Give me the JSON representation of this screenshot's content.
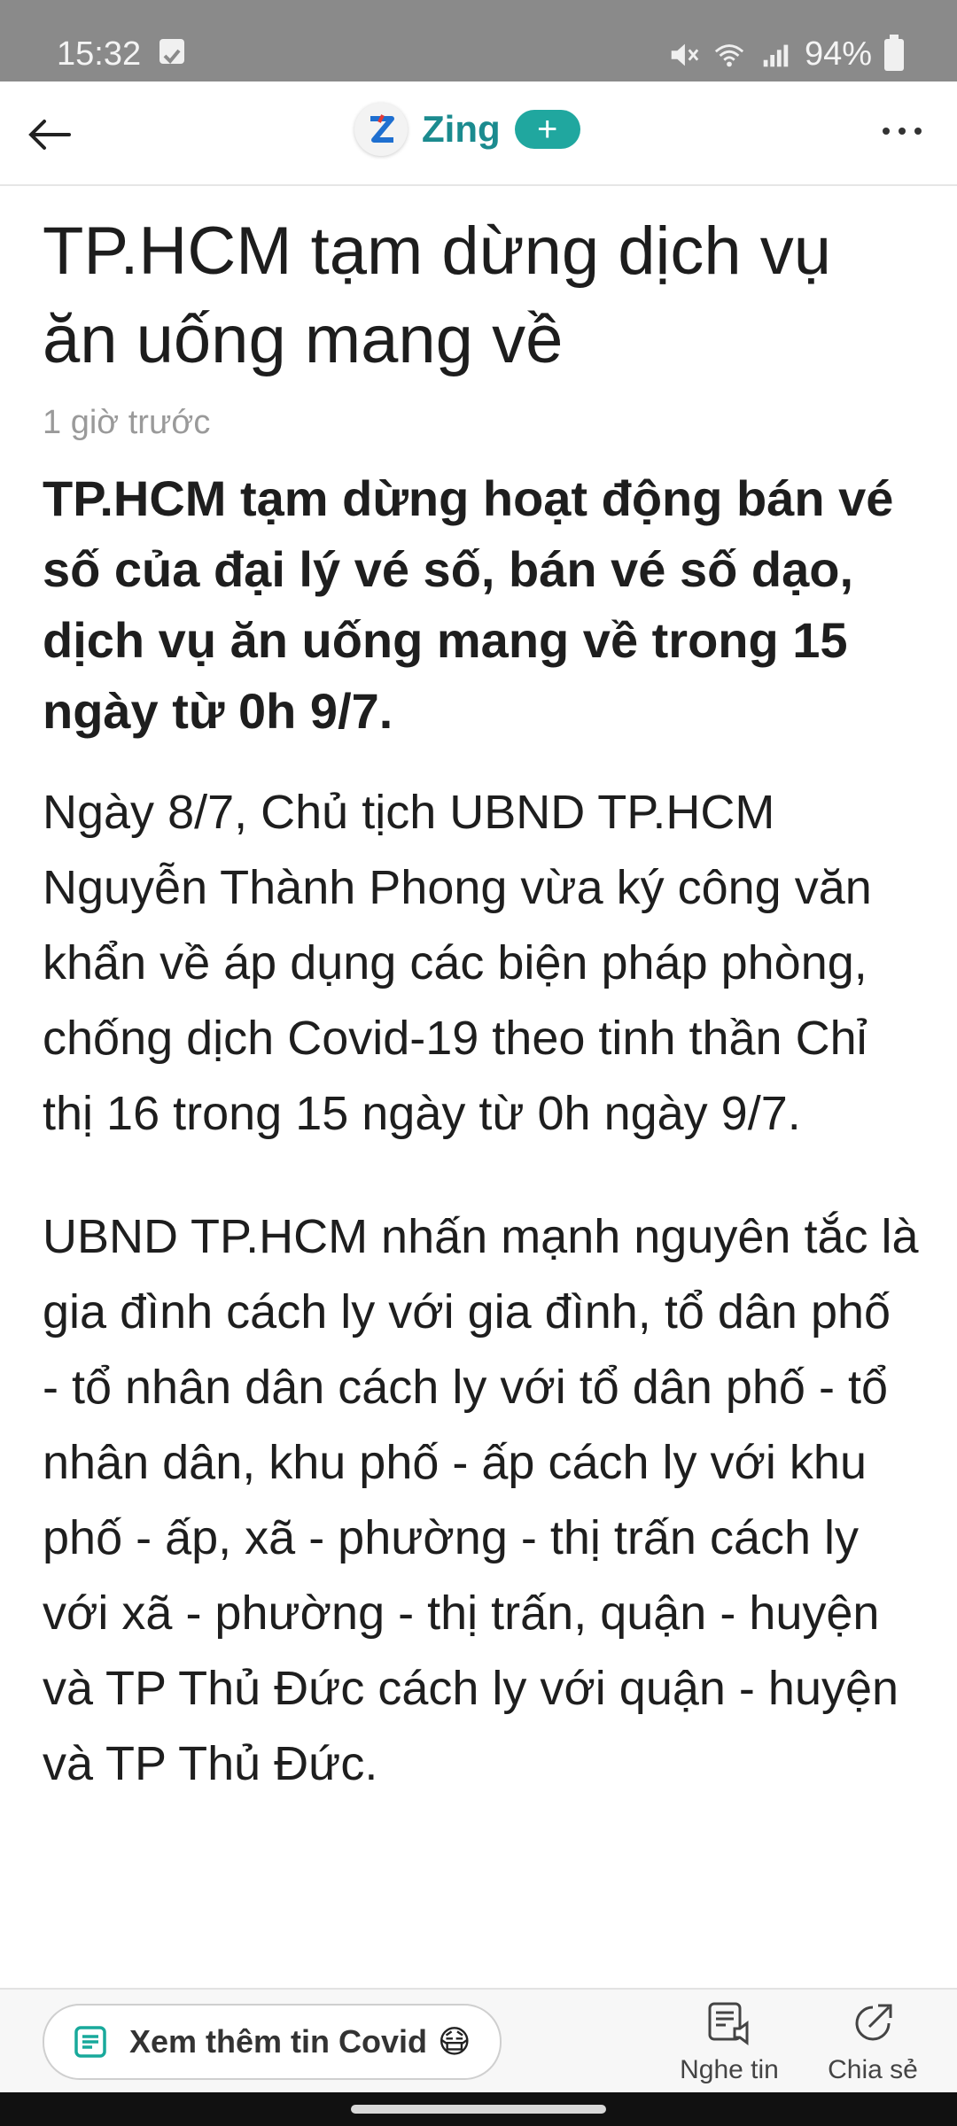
{
  "status": {
    "time": "15:32",
    "battery": "94%"
  },
  "header": {
    "brand": "Zing",
    "plus": "+"
  },
  "article": {
    "title": "TP.HCM tạm dừng dịch vụ ăn uống mang về",
    "time": "1 giờ trước",
    "lead": "TP.HCM tạm dừng hoạt động bán vé số của đại lý vé số, bán vé số dạo, dịch vụ ăn uống mang về trong 15 ngày từ 0h 9/7.",
    "paragraphs": [
      "Ngày 8/7, Chủ tịch UBND TP.HCM Nguyễn Thành Phong vừa ký công văn khẩn về áp dụng các biện pháp phòng, chống dịch Covid-19 theo tinh thần Chỉ thị 16 trong 15 ngày từ 0h ngày 9/7.",
      "UBND TP.HCM nhấn mạnh nguyên tắc là gia đình cách ly với gia đình, tổ dân phố - tổ nhân dân cách ly với tổ dân phố - tổ nhân dân, khu phố - ấp cách ly với khu phố - ấp, xã - phường - thị trấn cách ly với xã - phường - thị trấn, quận - huyện và TP Thủ Đức cách ly với quận - huyện và TP Thủ Đức."
    ]
  },
  "bottom": {
    "covid_button": "Xem thêm tin Covid",
    "covid_emoji": "😷",
    "listen": "Nghe tin",
    "share": "Chia sẻ"
  }
}
